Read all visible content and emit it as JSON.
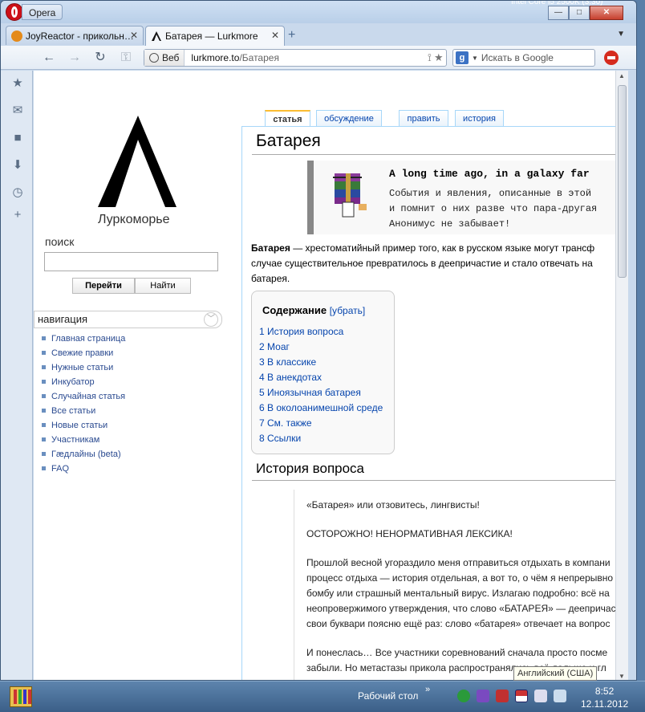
{
  "os": {
    "bg_text": "Intel Core i5 2500K (3.30)"
  },
  "window": {
    "opera_menu": "Opera",
    "controls": {
      "minimize": "—",
      "maximize": "□",
      "close": "✕"
    }
  },
  "tabs": [
    {
      "title": "JoyReactor - прикольн…",
      "close": "✕"
    },
    {
      "title": "Батарея — Lurkmore",
      "close": "✕"
    }
  ],
  "newtab": "+",
  "tabmenu": "▼",
  "toolbar": {
    "back": "←",
    "forward": "→",
    "reload": "↻",
    "key": "⚿",
    "badge": "Веб",
    "url_host": "lurkmore.to",
    "url_path": "/Батарея",
    "rss": "⟟",
    "star": "★",
    "search_engine": "g",
    "search_arrow": "▼",
    "search_placeholder": "Искать в Google"
  },
  "sidepanel": {
    "icons": [
      "★",
      "✉",
      "■",
      "⬇",
      "◷",
      "+"
    ]
  },
  "sidebar": {
    "site_name": "Луркоморье",
    "search_label": "поиск",
    "go_label": "Перейти",
    "find_label": "Найти",
    "nav_header": "навигация",
    "nav_chev": "﹀",
    "nav_items": [
      "Главная страница",
      "Свежие правки",
      "Нужные статьи",
      "Инкубатор",
      "Случайная статья",
      "Все статьи",
      "Новые статьи",
      "Участникам",
      "Гæдлайны (beta)",
      "FAQ"
    ]
  },
  "article_tabs": [
    "статья",
    "обсуждение",
    "править",
    "история"
  ],
  "article": {
    "title": "Батарея",
    "quote_title": "A long time ago, in a galaxy far",
    "quote_lines": [
      "События и явления, описанные в этой",
      "и помнит о них разве что пара-другая",
      "Анонимус не забывает!"
    ],
    "intro_bold": "Батарея",
    "intro_rest": " — хрестоматийный пример того, как в русском языке могут трансф",
    "intro_lines": [
      "случае существительное превратилось в деепричастие и стало отвечать на",
      "батарея."
    ],
    "toc_title": "Содержание",
    "toc_hide": "[убрать]",
    "toc_items": [
      "1 История вопроса",
      "2 Моаг",
      "3 В классике",
      "4 В анекдотах",
      "5 Иноязычная батарея",
      "6 В околоанимешной среде",
      "7 См. также",
      "8 Ссылки"
    ],
    "section_title": "История вопроса",
    "story": [
      "«Батарея» или отзовитесь, лингвисты!",
      "ОСТОРОЖНО! НЕНОРМАТИВНАЯ ЛЕКСИКА!",
      "Прошлой весной угораздило меня отправиться отдыхать в компани",
      "процесс отдыха — история отдельная, а вот то, о чём я непрерывно",
      "бомбу или страшный ментальный вирус. Излагаю подробно: всё на",
      "неопровержимого утверждения, что слово «БАТАРЕЯ» — деепричас",
      "свои буквари поясню ещё раз: слово «батарея» отвечает на вопрос",
      "И понеслась… Все участники соревнований сначала просто посме",
      "забыли. Но метастазы прикола распространялись всё дальше и гл"
    ]
  },
  "tooltip": "Английский (США)",
  "taskbar": {
    "desktop_label": "Рабочий стол",
    "chevron": "»",
    "time": "8:52",
    "date": "12.11.2012"
  }
}
